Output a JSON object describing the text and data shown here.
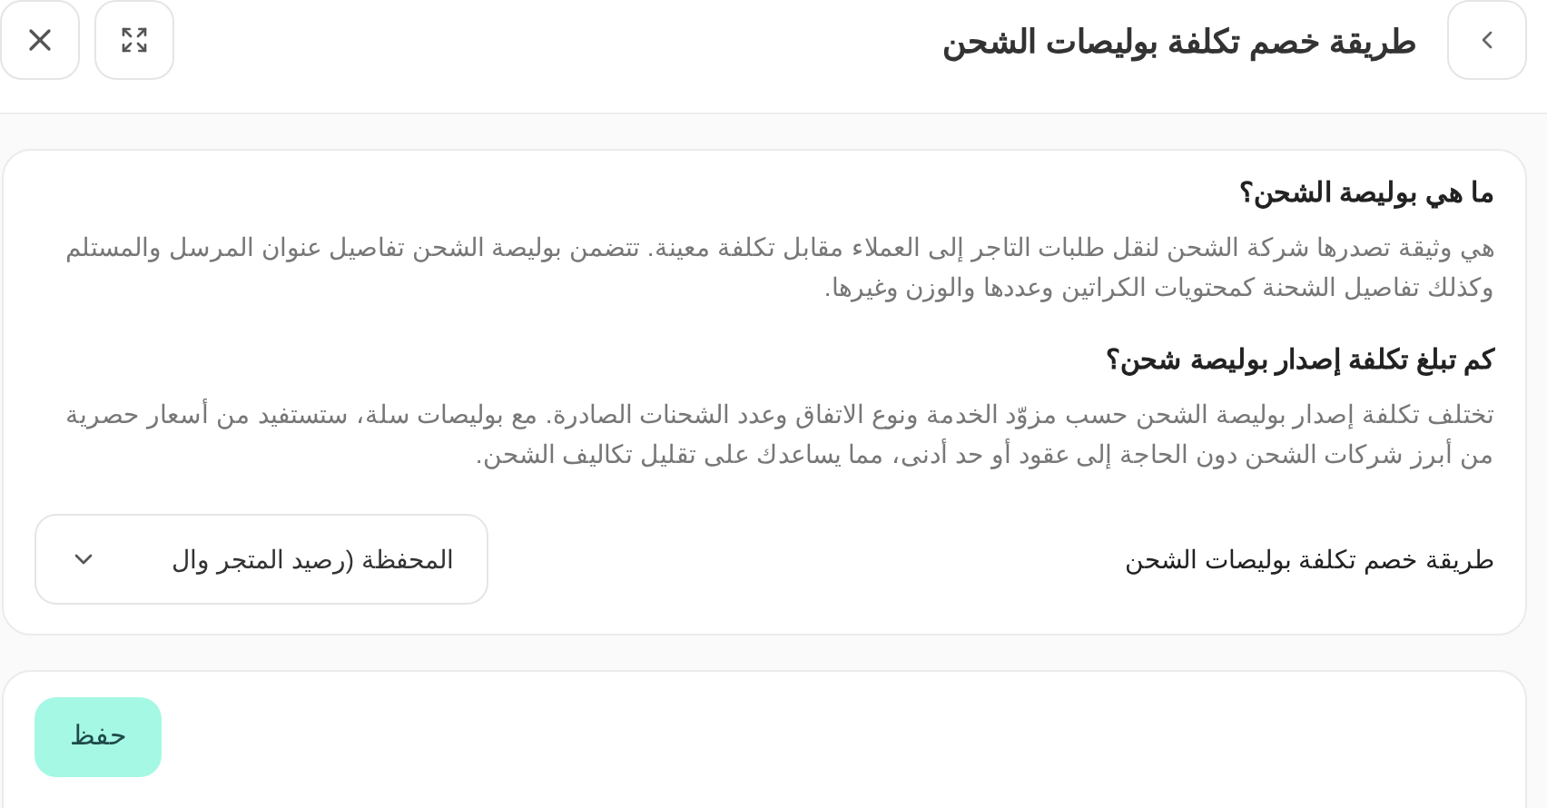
{
  "header": {
    "title": "طريقة خصم تكلفة بوليصات الشحن"
  },
  "faq": [
    {
      "question": "ما هي بوليصة الشحن؟",
      "answer": "هي وثيقة تصدرها شركة الشحن لنقل طلبات التاجر إلى العملاء مقابل تكلفة معينة. تتضمن بوليصة الشحن تفاصيل عنوان المرسل والمستلم وكذلك تفاصيل الشحنة كمحتويات الكراتين وعددها والوزن وغيرها."
    },
    {
      "question": "كم تبلغ تكلفة إصدار بوليصة شحن؟",
      "answer": "تختلف تكلفة إصدار بوليصة الشحن حسب مزوّد الخدمة ونوع الاتفاق وعدد الشحنات الصادرة. مع بوليصات سلة، ستستفيد من أسعار حصرية من أبرز شركات الشحن دون الحاجة إلى عقود أو حد أدنى، مما يساعدك على تقليل تكاليف الشحن."
    }
  ],
  "setting": {
    "label": "طريقة خصم تكلفة بوليصات الشحن",
    "value": "المحفظة (رصيد المتجر وال"
  },
  "save_button": "حفظ"
}
